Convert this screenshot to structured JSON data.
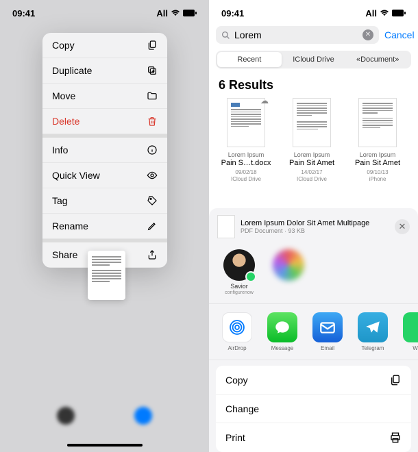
{
  "status": {
    "time": "09:41",
    "carrier": "All"
  },
  "left": {
    "menu": [
      {
        "label": "Copy",
        "icon": "copy"
      },
      {
        "label": "Duplicate",
        "icon": "duplicate"
      },
      {
        "label": "Move",
        "icon": "folder"
      },
      {
        "label": "Delete",
        "icon": "trash",
        "danger": true
      },
      {
        "label": "Info",
        "icon": "info",
        "sep": true
      },
      {
        "label": "Quick View",
        "icon": "eye"
      },
      {
        "label": "Tag",
        "icon": "tag"
      },
      {
        "label": "Rename",
        "icon": "pencil"
      },
      {
        "label": "Share",
        "icon": "share",
        "sep": true
      }
    ]
  },
  "right": {
    "search": {
      "query": "Lorem",
      "cancel": "Cancel"
    },
    "segments": [
      "Recent",
      "ICloud Drive",
      "«Document»"
    ],
    "results_header": "6 Results",
    "results": [
      {
        "subtitle": "Lorem Ipsum",
        "title": "Pain S…t.docx",
        "date": "09/02/18",
        "location": "ICloud Drive"
      },
      {
        "subtitle": "Lorem Ipsum",
        "title": "Pain Sit Amet",
        "date": "14/02/17",
        "location": "ICloud Drive"
      },
      {
        "subtitle": "Lorem Ipsum",
        "title": "Pain Sit Amet",
        "date": "09/10/13",
        "location": "iPhone"
      }
    ],
    "share": {
      "title": "Lorem Ipsum Dolor Sit Amet Multipage",
      "subtitle": "PDF Document · 93 KB",
      "contact": {
        "name": "Savior",
        "sub": "configurenow"
      },
      "apps": [
        {
          "name": "AirDrop"
        },
        {
          "name": "Message"
        },
        {
          "name": "Email"
        },
        {
          "name": "Telegram"
        },
        {
          "name": "W…"
        }
      ],
      "actions": [
        "Copy",
        "Change",
        "Print"
      ]
    }
  }
}
